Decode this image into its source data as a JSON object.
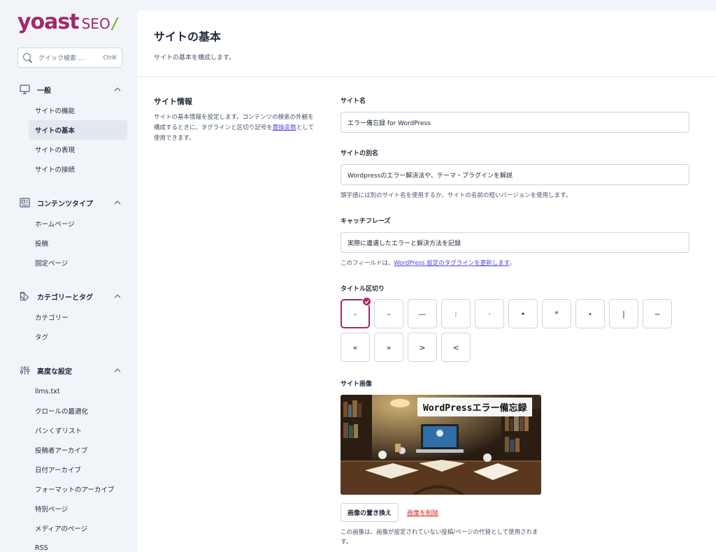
{
  "brand": {
    "name": "yoast",
    "suffix": "SEO",
    "slash": "/"
  },
  "search": {
    "placeholder": "クイック検索 ...",
    "shortcut": "CtrlK"
  },
  "sidebar": {
    "groups": [
      {
        "label": "一般",
        "icon": "desktop-icon",
        "items": [
          "サイトの機能",
          "サイトの基本",
          "サイトの表現",
          "サイトの接続"
        ],
        "active": "サイトの基本"
      },
      {
        "label": "コンテンツタイプ",
        "icon": "newspaper-icon",
        "items": [
          "ホームページ",
          "投稿",
          "固定ページ"
        ]
      },
      {
        "label": "カテゴリーとタグ",
        "icon": "tag-icon",
        "items": [
          "カテゴリー",
          "タグ"
        ]
      },
      {
        "label": "高度な設定",
        "icon": "sliders-icon",
        "items": [
          "llms.txt",
          "クロールの最適化",
          "パンくずリスト",
          "投稿者アーカイブ",
          "日付アーカイブ",
          "フォーマットのアーカイブ",
          "特別ページ",
          "メディアのページ",
          "RSS"
        ]
      }
    ]
  },
  "page": {
    "title": "サイトの基本",
    "subtitle": "サイトの基本を構成します。"
  },
  "section": {
    "title": "サイト情報",
    "desc_before": "サイトの基本情報を設定します。コンテンツの検索の外観を構成するときに、タグラインと区切り記号を",
    "desc_link": "置換変数",
    "desc_after": "として使用できます。"
  },
  "fields": {
    "site_name": {
      "label": "サイト名",
      "value": "エラー備忘録 for WordPress"
    },
    "alt_name": {
      "label": "サイトの別名",
      "value": "Wordpressのエラー解決法や、テーマ・プラグインを解説",
      "help": "頭字語には別のサイト名を使用するか、サイトの名前の短いバージョンを使用します。"
    },
    "tagline": {
      "label": "キャッチフレーズ",
      "value": "実際に遭遇したエラーと解決方法を記録",
      "help_before": "このフィールドは、",
      "help_link": "WordPress 設定のタグラインを更新します",
      "help_after": "。"
    },
    "separator": {
      "label": "タイトル区切り",
      "options": [
        "-",
        "–",
        "—",
        ":",
        "·",
        "•",
        "*",
        "⋆",
        "|",
        "~",
        "«",
        "»",
        ">",
        "<"
      ],
      "selected": "-"
    },
    "site_image": {
      "label": "サイト画像",
      "caption": "WordPressエラー備忘録",
      "replace_label": "画像の置き換え",
      "remove_label": "画像を削除",
      "help": "この画像は、画像が設定されていない投稿/ページの代替として使用されます。"
    }
  },
  "colors": {
    "brand": "#a4286a",
    "accent_green": "#77b227",
    "link": "#4f46e5",
    "danger": "#dc2626"
  }
}
